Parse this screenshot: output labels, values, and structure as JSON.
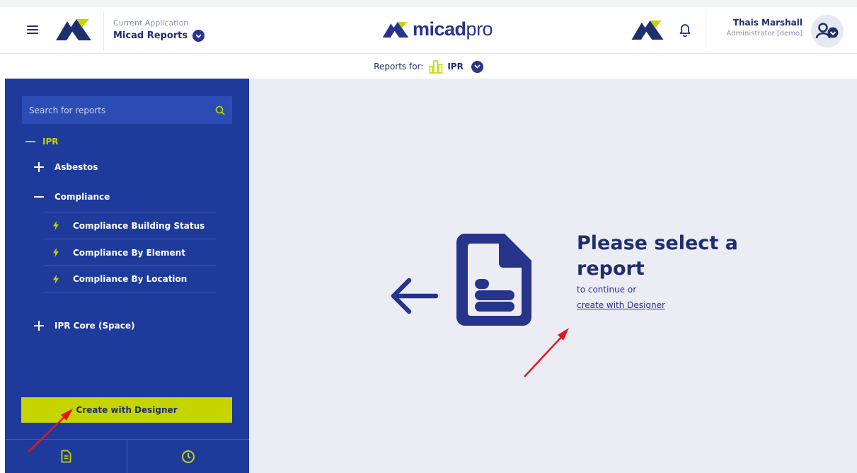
{
  "header": {
    "app_caption": "Current Application",
    "app_name": "Micad Reports",
    "brand_name": "micad",
    "brand_suffix": "pro",
    "user_name": "Thais Marshall",
    "user_role": "Administrator [demo]"
  },
  "reports_bar": {
    "label": "Reports for:",
    "target": "IPR"
  },
  "sidebar": {
    "search_placeholder": "Search for reports",
    "tree": {
      "root": "IPR",
      "asbestos": "Asbestos",
      "compliance": "Compliance",
      "compliance_items": [
        "Compliance Building Status",
        "Compliance By Element",
        "Compliance By Location"
      ],
      "ipr_core": "IPR Core (Space)"
    },
    "create_button": "Create with Designer"
  },
  "main": {
    "title": "Please select a report",
    "subtitle": "to continue or",
    "link": "create with Designer"
  },
  "colors": {
    "brand_navy": "#27348b",
    "sidebar_bg": "#1e3a9b",
    "accent_lime": "#c6d400",
    "main_bg": "#ecedf4",
    "annotation_red": "#e8141b"
  },
  "icons": [
    "hamburger-icon",
    "logo-mark-icon",
    "chevron-down-icon",
    "bell-icon",
    "user-settings-icon",
    "building-icon",
    "search-icon",
    "plus-icon",
    "minus-icon",
    "bolt-icon",
    "document-icon",
    "clock-icon",
    "arrow-left-icon"
  ]
}
